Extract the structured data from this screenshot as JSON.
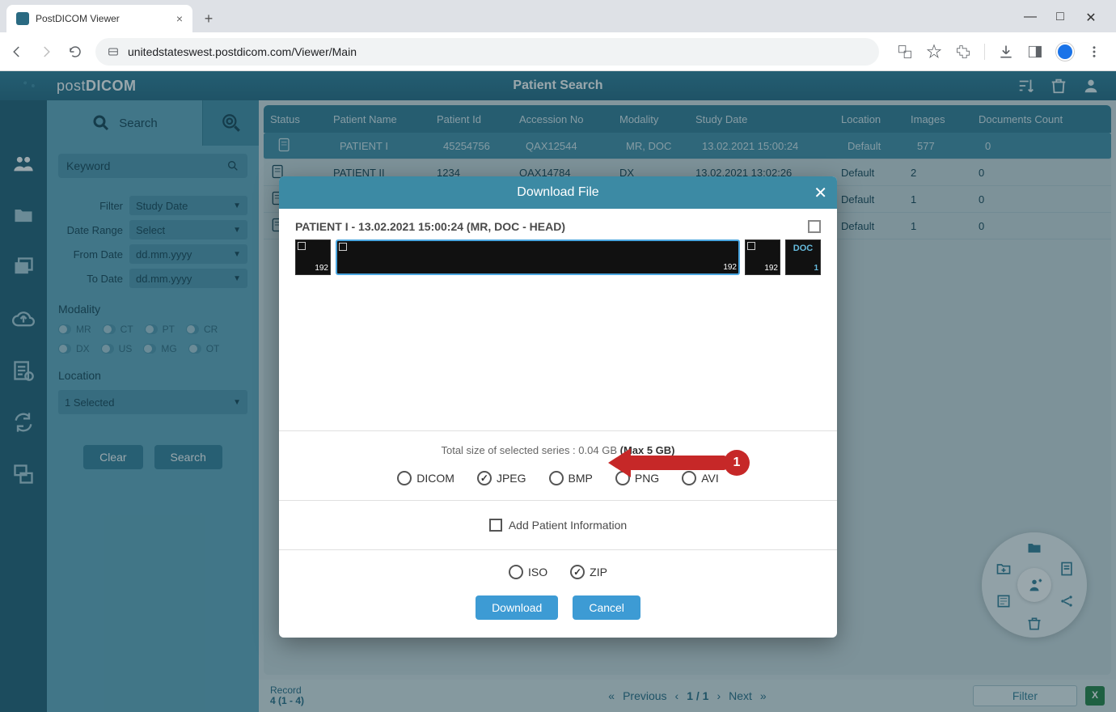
{
  "browser": {
    "tab_title": "PostDICOM Viewer",
    "url_display": "unitedstateswest.postdicom.com/Viewer/Main"
  },
  "app": {
    "logo": "postDICOM",
    "page_title": "Patient Search"
  },
  "search": {
    "tab_label": "Search",
    "keyword_placeholder": "Keyword",
    "filter_label": "Filter",
    "filter_value": "Study Date",
    "daterange_label": "Date Range",
    "daterange_value": "Select",
    "fromdate_label": "From Date",
    "fromdate_value": "dd.mm.yyyy",
    "todate_label": "To Date",
    "todate_value": "dd.mm.yyyy",
    "modality_label": "Modality",
    "modalities": [
      "MR",
      "CT",
      "PT",
      "CR",
      "DX",
      "US",
      "MG",
      "OT"
    ],
    "location_label": "Location",
    "location_value": "1 Selected",
    "clear_btn": "Clear",
    "search_btn": "Search"
  },
  "grid": {
    "headers": {
      "status": "Status",
      "pname": "Patient Name",
      "pid": "Patient Id",
      "acc": "Accession No",
      "mod": "Modality",
      "date": "Study Date",
      "loc": "Location",
      "img": "Images",
      "docs": "Documents Count"
    },
    "rows": [
      {
        "pname": "PATIENT I",
        "pid": "45254756",
        "acc": "QAX12544",
        "mod": "MR, DOC",
        "date": "13.02.2021 15:00:24",
        "loc": "Default",
        "img": "577",
        "docs": "0",
        "selected": true
      },
      {
        "pname": "PATIENT II",
        "pid": "1234",
        "acc": "QAX14784",
        "mod": "DX",
        "date": "13.02.2021 13:02:26",
        "loc": "Default",
        "img": "2",
        "docs": "0",
        "selected": false
      },
      {
        "pname": "",
        "pid": "",
        "acc": "",
        "mod": "",
        "date": "",
        "loc": "Default",
        "img": "1",
        "docs": "0",
        "selected": false
      },
      {
        "pname": "",
        "pid": "",
        "acc": "",
        "mod": "",
        "date": "",
        "loc": "Default",
        "img": "1",
        "docs": "0",
        "selected": false
      }
    ]
  },
  "footer": {
    "record_label": "Record",
    "record_value": "4 (1 - 4)",
    "prev": "Previous",
    "page": "1 / 1",
    "next": "Next",
    "filter_btn": "Filter"
  },
  "modal": {
    "title": "Download File",
    "study_line": "PATIENT I - 13.02.2021 15:00:24 (MR, DOC - HEAD)",
    "thumbs": [
      {
        "count": "192",
        "selected": false,
        "type": "img"
      },
      {
        "count": "192",
        "selected": true,
        "type": "img"
      },
      {
        "count": "192",
        "selected": false,
        "type": "img"
      },
      {
        "count": "1",
        "selected": false,
        "type": "doc",
        "label": "DOC"
      }
    ],
    "size_prefix": "Total size of selected series : ",
    "size_value": "0.04 GB ",
    "size_max": "(Max 5 GB)",
    "formats": [
      {
        "label": "DICOM",
        "checked": false
      },
      {
        "label": "JPEG",
        "checked": true
      },
      {
        "label": "BMP",
        "checked": false
      },
      {
        "label": "PNG",
        "checked": false
      },
      {
        "label": "AVI",
        "checked": false
      }
    ],
    "add_patient_info": "Add Patient Information",
    "archives": [
      {
        "label": "ISO",
        "checked": false
      },
      {
        "label": "ZIP",
        "checked": true
      }
    ],
    "download_btn": "Download",
    "cancel_btn": "Cancel"
  },
  "annotation": {
    "badge": "1"
  }
}
